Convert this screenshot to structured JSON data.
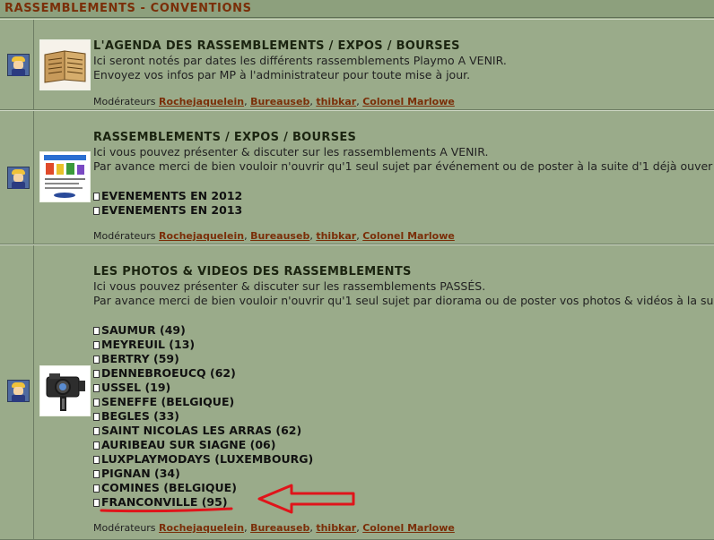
{
  "header": {
    "title": "RASSEMBLEMENTS - CONVENTIONS"
  },
  "forums": [
    {
      "title": "L'AGENDA DES RASSEMBLEMENTS / EXPOS / BOURSES",
      "desc": [
        "Ici seront notés par dates les différents rassemblements Playmo A VENIR.",
        "Envoyez vos infos par MP à l'administrateur pour toute mise à jour."
      ],
      "subforums": [],
      "moderators_label": "Modérateurs",
      "moderators": [
        "Rochejaquelein",
        "Bureauseb",
        "thibkar",
        "Colonel Marlowe"
      ]
    },
    {
      "title": "RASSEMBLEMENTS / EXPOS / BOURSES",
      "desc": [
        "Ici vous pouvez présenter & discuter sur les rassemblements A VENIR.",
        "Par avance merci de bien vouloir n'ouvrir qu'1 seul sujet par événement ou de poster à la suite d'1 déjà ouver"
      ],
      "subforums": [
        "EVENEMENTS EN 2012",
        "EVENEMENTS EN 2013"
      ],
      "moderators_label": "Modérateurs",
      "moderators": [
        "Rochejaquelein",
        "Bureauseb",
        "thibkar",
        "Colonel Marlowe"
      ]
    },
    {
      "title": "LES PHOTOS & VIDEOS DES RASSEMBLEMENTS",
      "desc": [
        "Ici vous pouvez présenter & discuter sur les rassemblements PASSÉS.",
        "Par avance merci de bien vouloir n'ouvrir qu'1 seul sujet par diorama ou de poster vos photos & vidéos à la su"
      ],
      "subforums": [
        "SAUMUR (49)",
        "MEYREUIL (13)",
        "BERTRY (59)",
        "DENNEBROEUCQ (62)",
        "USSEL (19)",
        "SENEFFE (BELGIQUE)",
        "BEGLES (33)",
        "SAINT NICOLAS LES ARRAS (62)",
        "AURIBEAU SUR SIAGNE (06)",
        "LUXPLAYMODAYS (LUXEMBOURG)",
        "PIGNAN (34)",
        "COMINES (BELGIQUE)",
        "FRANCONVILLE (95)"
      ],
      "moderators_label": "Modérateurs",
      "moderators": [
        "Rochejaquelein",
        "Bureauseb",
        "thibkar",
        "Colonel Marlowe"
      ]
    }
  ],
  "icons": {
    "avatar": "playmobil-avatar-icon",
    "thumb1": "old-book-icon",
    "thumb2": "event-poster-icon",
    "thumb3": "camera-icon",
    "subforum": "document-icon",
    "annotation": "red-arrow-icon"
  },
  "colors": {
    "background": "#9aab8a",
    "header_text": "#7a2e08",
    "link": "#7a2e08",
    "annotation": "#e0141a"
  }
}
